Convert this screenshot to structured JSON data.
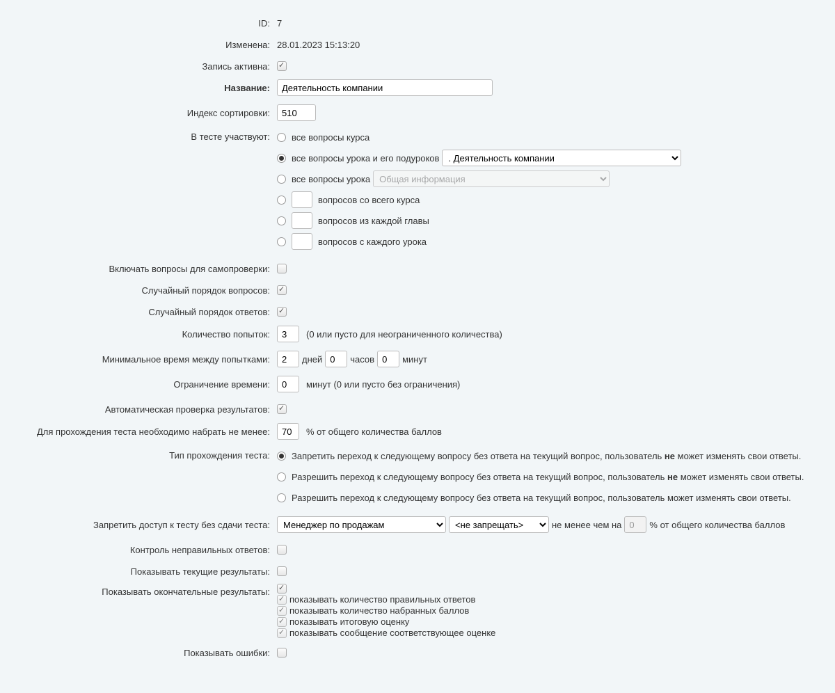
{
  "labels": {
    "id": "ID:",
    "modified": "Изменена:",
    "active": "Запись активна:",
    "name": "Название:",
    "sortIndex": "Индекс сортировки:",
    "inTest": "В тесте участвуют:",
    "selfCheck": "Включать вопросы для самопроверки:",
    "randQ": "Случайный порядок вопросов:",
    "randA": "Случайный порядок ответов:",
    "attempts": "Количество попыток:",
    "minTime": "Минимальное время между попытками:",
    "timeLimit": "Ограничение времени:",
    "autoCheck": "Автоматическая проверка результатов:",
    "passScore": "Для прохождения теста необходимо набрать не менее:",
    "passType": "Тип прохождения теста:",
    "prereq": "Запретить доступ к тесту без сдачи теста:",
    "wrongCtrl": "Контроль неправильных ответов:",
    "showCurrent": "Показывать текущие результаты:",
    "showFinal": "Показывать окончательные результаты:",
    "showErrors": "Показывать ошибки:"
  },
  "values": {
    "id": "7",
    "modified": "28.01.2023 15:13:20",
    "name": "Деятельность компании",
    "sortIndex": "510",
    "attempts": "3",
    "interval": {
      "days": "2",
      "hours": "0",
      "minutes": "0"
    },
    "timeLimit": "0",
    "passScore": "70",
    "prereqPct": "0"
  },
  "radios": {
    "allCourse": "все вопросы курса",
    "allLesson": "все вопросы урока и его подуроков",
    "allChapter": "все вопросы урока",
    "nCourse": "вопросов со всего курса",
    "nChapter": "вопросов из каждой главы",
    "nLesson": "вопросов с каждого урока"
  },
  "selects": {
    "lesson": ". Деятельность компании",
    "chapter": "Общая информация",
    "prereq1": "Менеджер по продажам",
    "prereq2": "<не запрещать>"
  },
  "passTypes": {
    "p1a": "Запретить переход к следующему вопросу без ответа на текущий вопрос, пользователь ",
    "p1b": " может изменять свои ответы.",
    "p2a": "Разрешить переход к следующему вопросу без ответа на текущий вопрос, пользователь ",
    "p2b": " может изменять свои ответы.",
    "p3": "Разрешить переход к следующему вопросу без ответа на текущий вопрос, пользователь может изменять свои ответы.",
    "ne": "не"
  },
  "hints": {
    "attempts": "(0 или пусто для неограниченного количества)",
    "days": "дней",
    "hours": "часов",
    "minutes": "минут",
    "timeLimit": "минут (0 или пусто без ограничения)",
    "passScore": "% от общего количества баллов",
    "prereqMid": "не менее чем на",
    "prereqEnd": "% от общего количества баллов"
  },
  "finalSubs": {
    "s1": "показывать количество правильных ответов",
    "s2": "показывать количество набранных баллов",
    "s3": "показывать итоговую оценку",
    "s4": "показывать сообщение соответствующее оценке"
  }
}
